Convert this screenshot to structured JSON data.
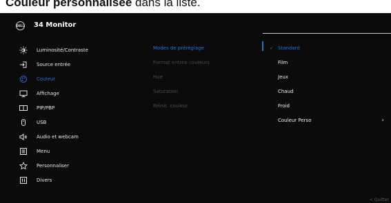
{
  "doc": {
    "heading_bold": "Couleur personnalisée",
    "heading_rest": " dans la liste."
  },
  "osd": {
    "logo_text": "DELL",
    "title": "34 Monitor"
  },
  "menu": [
    {
      "label": "Luminosité/Contraste",
      "icon": "brightness-icon",
      "active": false
    },
    {
      "label": "Source entrée",
      "icon": "input-source-icon",
      "active": false
    },
    {
      "label": "Couleur",
      "icon": "color-icon",
      "active": true
    },
    {
      "label": "Affichage",
      "icon": "display-icon",
      "active": false
    },
    {
      "label": "PIP/PBP",
      "icon": "pip-pbp-icon",
      "active": false
    },
    {
      "label": "USB",
      "icon": "usb-icon",
      "active": false
    },
    {
      "label": "Audio et webcam",
      "icon": "audio-webcam-icon",
      "active": false
    },
    {
      "label": "Menu",
      "icon": "menu-icon",
      "active": false
    },
    {
      "label": "Personnaliser",
      "icon": "star-icon",
      "active": false
    },
    {
      "label": "Divers",
      "icon": "misc-icon",
      "active": false
    }
  ],
  "submenu": [
    {
      "label": "Modes de préréglage",
      "active": true
    },
    {
      "label": "Format entrée couleurs",
      "active": false
    },
    {
      "label": "Hue",
      "active": false
    },
    {
      "label": "Saturation",
      "active": false
    },
    {
      "label": "Réinit. couleur",
      "active": false
    }
  ],
  "options": [
    {
      "label": "Standard",
      "selected": true,
      "has_submenu": false
    },
    {
      "label": "Film",
      "selected": false,
      "has_submenu": false
    },
    {
      "label": "Jeux",
      "selected": false,
      "has_submenu": false
    },
    {
      "label": "Chaud",
      "selected": false,
      "has_submenu": false
    },
    {
      "label": "Froid",
      "selected": false,
      "has_submenu": false
    },
    {
      "label": "Couleur Perso",
      "selected": false,
      "has_submenu": true
    }
  ],
  "footer": {
    "quit_label": "< Quitter"
  },
  "colors": {
    "background": "#0b0b0b",
    "accent": "#2c6fd6",
    "text": "#eaeaea",
    "disabled_text": "#4a4a4a"
  }
}
